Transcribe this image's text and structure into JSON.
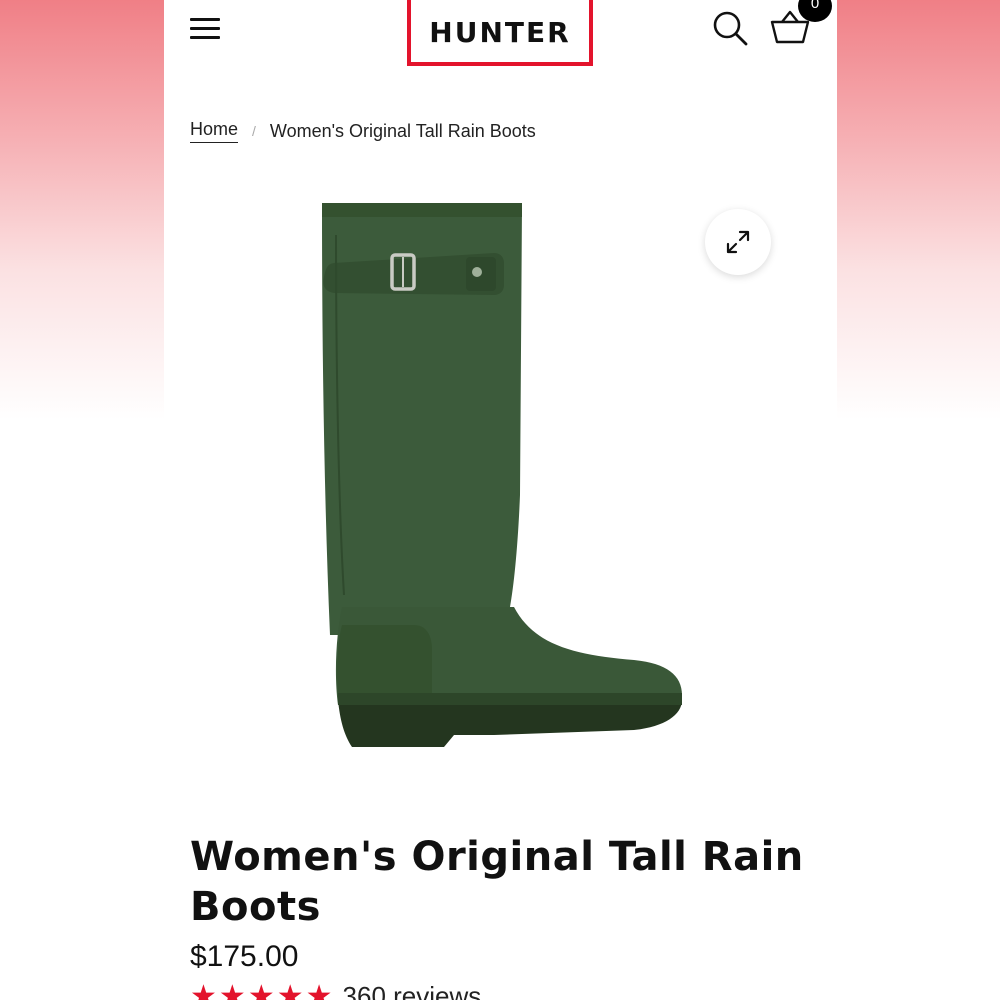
{
  "header": {
    "logo_text": "HUNTER",
    "cart_count": "0"
  },
  "breadcrumb": {
    "home_label": "Home",
    "separator": "/",
    "current_label": "Women's Original Tall Rain Boots"
  },
  "product": {
    "title": "Women's Original Tall Rain Boots",
    "price": "$175.00",
    "rating": 5,
    "reviews_label": "360 reviews",
    "image_icon": "green-tall-rain-boot",
    "boot_color": "#3b5a3a"
  },
  "colors": {
    "brand_red": "#e3132c",
    "text": "#111111"
  }
}
